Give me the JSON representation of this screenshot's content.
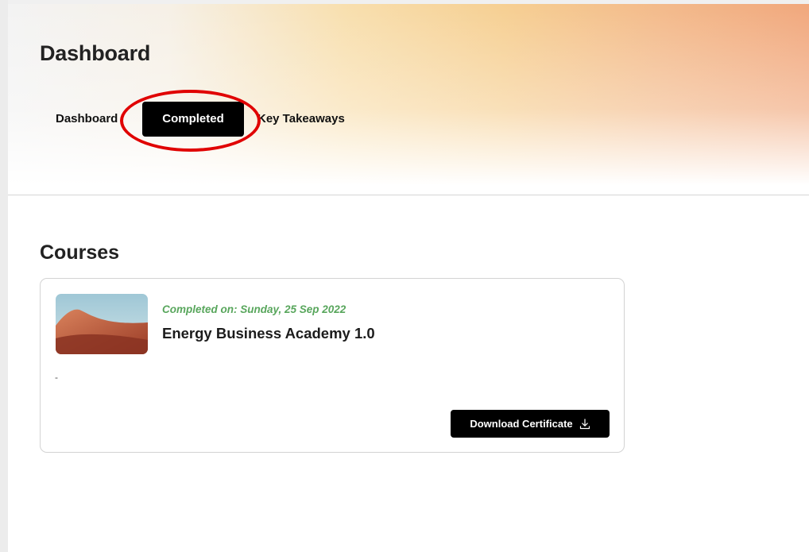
{
  "header": {
    "title": "Dashboard"
  },
  "tabs": [
    {
      "label": "Dashboard",
      "active": false
    },
    {
      "label": "Completed",
      "active": true
    },
    {
      "label": "Key Takeaways",
      "active": false
    }
  ],
  "colors": {
    "active_tab_bg": "#000000",
    "highlight_ring": "#e00000",
    "completed_text": "#58a65c"
  },
  "courses": {
    "section_title": "Courses",
    "items": [
      {
        "completed_on": "Completed on: Sunday, 25 Sep 2022",
        "name": "Energy Business Academy 1.0",
        "description": "-",
        "thumbnail_icon": "desert-landscape-image",
        "download_label": "Download Certificate",
        "download_icon": "download-icon"
      }
    ]
  }
}
